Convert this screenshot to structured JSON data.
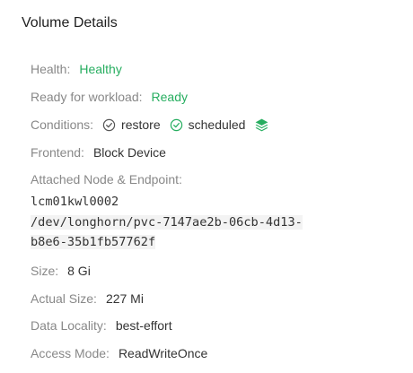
{
  "title": "Volume Details",
  "health": {
    "label": "Health:",
    "value": "Healthy"
  },
  "ready": {
    "label": "Ready for workload:",
    "value": "Ready"
  },
  "conditions": {
    "label": "Conditions:",
    "items": [
      "restore",
      "scheduled"
    ]
  },
  "frontend": {
    "label": "Frontend:",
    "value": "Block Device"
  },
  "attached": {
    "label": "Attached Node & Endpoint:",
    "node": "lcm01kwl0002",
    "endpoint_line1": "/dev/longhorn/pvc-7147ae2b-06cb-4d13-",
    "endpoint_line2": "b8e6-35b1fb57762f"
  },
  "size": {
    "label": "Size:",
    "value": "8 Gi"
  },
  "actual_size": {
    "label": "Actual Size:",
    "value": "227 Mi"
  },
  "data_locality": {
    "label": "Data Locality:",
    "value": "best-effort"
  },
  "access_mode": {
    "label": "Access Mode:",
    "value": "ReadWriteOnce"
  },
  "colors": {
    "green": "#27ae60",
    "label": "#888888",
    "text": "#333333"
  }
}
